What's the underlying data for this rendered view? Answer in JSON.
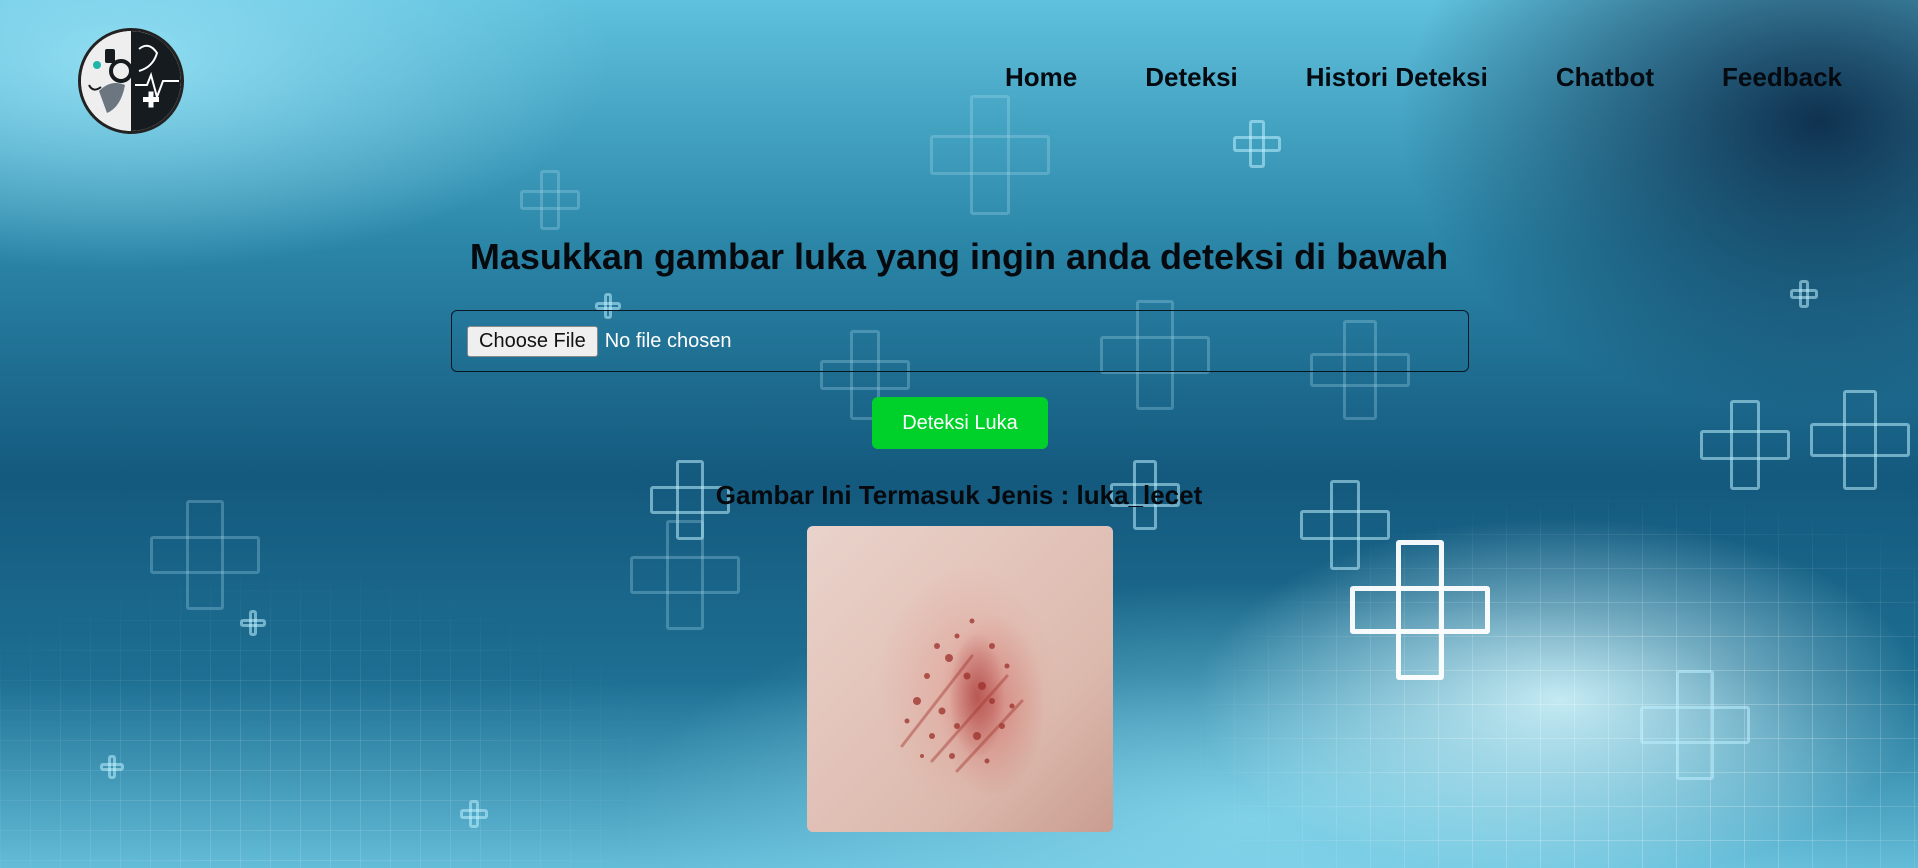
{
  "nav": {
    "items": [
      {
        "label": "Home"
      },
      {
        "label": "Deteksi"
      },
      {
        "label": "Histori Deteksi"
      },
      {
        "label": "Chatbot"
      },
      {
        "label": "Feedback"
      }
    ]
  },
  "main": {
    "title": "Masukkan gambar luka yang ingin anda deteksi di bawah",
    "file_input": {
      "button_label": "Choose File",
      "status": "No file chosen"
    },
    "detect_button_label": "Deteksi Luka",
    "result_text": "Gambar Ini Termasuk Jenis : luka_lecet"
  },
  "colors": {
    "detect_button": "#00d12a",
    "text_dark": "#060a0e",
    "background_primary": "#14597e"
  },
  "icons": {
    "logo": "medical-logo-icon",
    "decorative": "medical-cross-icon"
  }
}
